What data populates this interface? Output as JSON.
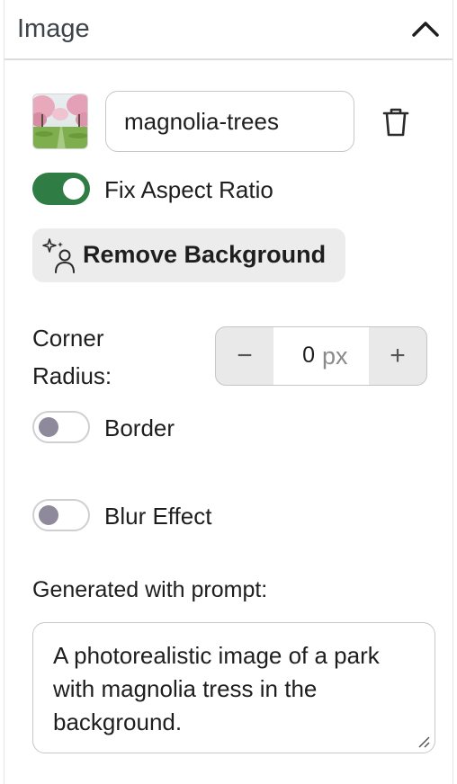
{
  "header": {
    "title": "Image"
  },
  "image": {
    "name_value": "magnolia-trees",
    "fix_aspect_ratio_label": "Fix Aspect Ratio",
    "fix_aspect_ratio_on": true
  },
  "remove_background": {
    "label": "Remove Background"
  },
  "corner_radius": {
    "label_line1": "Corner",
    "label_line2": "Radius:",
    "value": "0",
    "unit": "px",
    "minus": "−",
    "plus": "+"
  },
  "border": {
    "label": "Border",
    "on": false
  },
  "blur": {
    "label": "Blur Effect",
    "on": false
  },
  "prompt": {
    "label": "Generated with prompt:",
    "text": "A photorealistic image of a park with magnolia tress in the background."
  },
  "colors": {
    "toggle_on": "#2f7d45",
    "toggle_off_knob": "#8f8a9b",
    "button_bg": "#ececec"
  },
  "icons": [
    "chevron-up-icon",
    "trash-icon",
    "sparkle-person-icon",
    "resize-grip-icon"
  ]
}
